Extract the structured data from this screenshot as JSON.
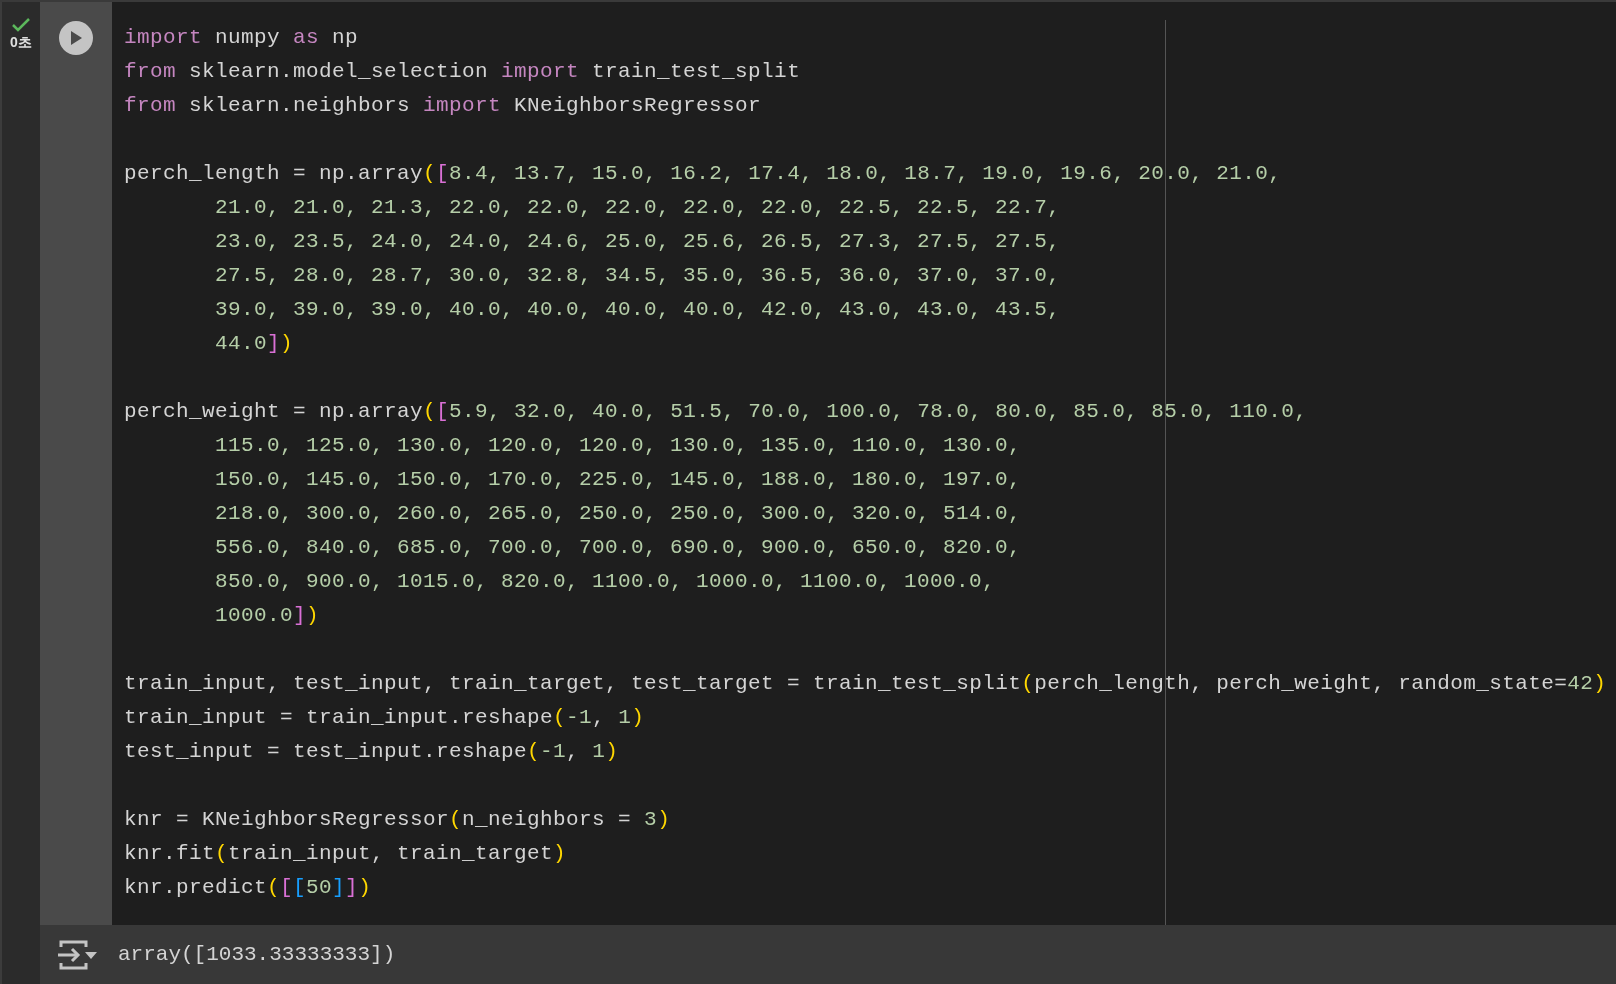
{
  "cell": {
    "succeeded": true,
    "duration": "0초",
    "code_blocks": [
      [
        [
          {
            "kind": "keyword",
            "text": "import"
          },
          {
            "kind": "plain",
            "text": " numpy "
          },
          {
            "kind": "keyword",
            "text": "as"
          },
          {
            "kind": "plain",
            "text": " np"
          }
        ],
        [
          {
            "kind": "keyword",
            "text": "from"
          },
          {
            "kind": "plain",
            "text": " sklearn.model_selection "
          },
          {
            "kind": "keyword",
            "text": "import"
          },
          {
            "kind": "plain",
            "text": " train_test_split"
          }
        ],
        [
          {
            "kind": "keyword",
            "text": "from"
          },
          {
            "kind": "plain",
            "text": " sklearn.neighbors "
          },
          {
            "kind": "keyword",
            "text": "import"
          },
          {
            "kind": "plain",
            "text": " KNeighborsRegressor"
          }
        ]
      ],
      [
        [
          {
            "kind": "plain",
            "text": "perch_length = np.array"
          },
          {
            "kind": "paren1",
            "text": "("
          },
          {
            "kind": "paren2",
            "text": "["
          },
          {
            "kind": "number",
            "text": "8.4, 13.7, 15.0, 16.2, 17.4, 18.0, 18.7, 19.0, 19.6, 20.0, 21.0,"
          }
        ],
        [
          {
            "kind": "indent"
          },
          {
            "kind": "number",
            "text": "21.0, 21.0, 21.3, 22.0, 22.0, 22.0, 22.0, 22.0, 22.5, 22.5, 22.7,"
          }
        ],
        [
          {
            "kind": "indent"
          },
          {
            "kind": "number",
            "text": "23.0, 23.5, 24.0, 24.0, 24.6, 25.0, 25.6, 26.5, 27.3, 27.5, 27.5,"
          }
        ],
        [
          {
            "kind": "indent"
          },
          {
            "kind": "number",
            "text": "27.5, 28.0, 28.7, 30.0, 32.8, 34.5, 35.0, 36.5, 36.0, 37.0, 37.0,"
          }
        ],
        [
          {
            "kind": "indent"
          },
          {
            "kind": "number",
            "text": "39.0, 39.0, 39.0, 40.0, 40.0, 40.0, 40.0, 42.0, 43.0, 43.0, 43.5,"
          }
        ],
        [
          {
            "kind": "indent"
          },
          {
            "kind": "number",
            "text": "44.0"
          },
          {
            "kind": "paren2",
            "text": "]"
          },
          {
            "kind": "paren1",
            "text": ")"
          }
        ]
      ],
      [
        [
          {
            "kind": "plain",
            "text": "perch_weight = np.array"
          },
          {
            "kind": "paren1",
            "text": "("
          },
          {
            "kind": "paren2",
            "text": "["
          },
          {
            "kind": "number",
            "text": "5.9, 32.0, 40.0, 51.5, 70.0, 100.0, 78.0, 80.0, 85.0, 85.0, 110.0,"
          }
        ],
        [
          {
            "kind": "indent"
          },
          {
            "kind": "number",
            "text": "115.0, 125.0, 130.0, 120.0, 120.0, 130.0, 135.0, 110.0, 130.0,"
          }
        ],
        [
          {
            "kind": "indent"
          },
          {
            "kind": "number",
            "text": "150.0, 145.0, 150.0, 170.0, 225.0, 145.0, 188.0, 180.0, 197.0,"
          }
        ],
        [
          {
            "kind": "indent"
          },
          {
            "kind": "number",
            "text": "218.0, 300.0, 260.0, 265.0, 250.0, 250.0, 300.0, 320.0, 514.0,"
          }
        ],
        [
          {
            "kind": "indent"
          },
          {
            "kind": "number",
            "text": "556.0, 840.0, 685.0, 700.0, 700.0, 690.0, 900.0, 650.0, 820.0,"
          }
        ],
        [
          {
            "kind": "indent"
          },
          {
            "kind": "number",
            "text": "850.0, 900.0, 1015.0, 820.0, 1100.0, 1000.0, 1100.0, 1000.0,"
          }
        ],
        [
          {
            "kind": "indent"
          },
          {
            "kind": "number",
            "text": "1000.0"
          },
          {
            "kind": "paren2",
            "text": "]"
          },
          {
            "kind": "paren1",
            "text": ")"
          }
        ]
      ],
      [
        [
          {
            "kind": "plain",
            "text": "train_input, test_input, train_target, test_target = train_test_split"
          },
          {
            "kind": "paren1",
            "text": "("
          },
          {
            "kind": "plain",
            "text": "perch_length, perch_weight, random_state="
          },
          {
            "kind": "number",
            "text": "42"
          },
          {
            "kind": "paren1",
            "text": ")"
          }
        ],
        [
          {
            "kind": "plain",
            "text": "train_input = train_input.reshape"
          },
          {
            "kind": "paren1",
            "text": "("
          },
          {
            "kind": "number",
            "text": "-1"
          },
          {
            "kind": "plain",
            "text": ", "
          },
          {
            "kind": "number",
            "text": "1"
          },
          {
            "kind": "paren1",
            "text": ")"
          }
        ],
        [
          {
            "kind": "plain",
            "text": "test_input = test_input.reshape"
          },
          {
            "kind": "paren1",
            "text": "("
          },
          {
            "kind": "number",
            "text": "-1"
          },
          {
            "kind": "plain",
            "text": ", "
          },
          {
            "kind": "number",
            "text": "1"
          },
          {
            "kind": "paren1",
            "text": ")"
          }
        ]
      ],
      [
        [
          {
            "kind": "plain",
            "text": "knr = KNeighborsRegressor"
          },
          {
            "kind": "paren1",
            "text": "("
          },
          {
            "kind": "plain",
            "text": "n_neighbors = "
          },
          {
            "kind": "number",
            "text": "3"
          },
          {
            "kind": "paren1",
            "text": ")"
          }
        ],
        [
          {
            "kind": "plain",
            "text": "knr.fit"
          },
          {
            "kind": "paren1",
            "text": "("
          },
          {
            "kind": "plain",
            "text": "train_input, train_target"
          },
          {
            "kind": "paren1",
            "text": ")"
          }
        ],
        [
          {
            "kind": "plain",
            "text": "knr.predict"
          },
          {
            "kind": "paren1",
            "text": "("
          },
          {
            "kind": "paren2",
            "text": "["
          },
          {
            "kind": "paren3",
            "text": "["
          },
          {
            "kind": "number",
            "text": "50"
          },
          {
            "kind": "paren3",
            "text": "]"
          },
          {
            "kind": "paren2",
            "text": "]"
          },
          {
            "kind": "paren1",
            "text": ")"
          }
        ]
      ]
    ],
    "output": "array([1033.33333333])"
  }
}
